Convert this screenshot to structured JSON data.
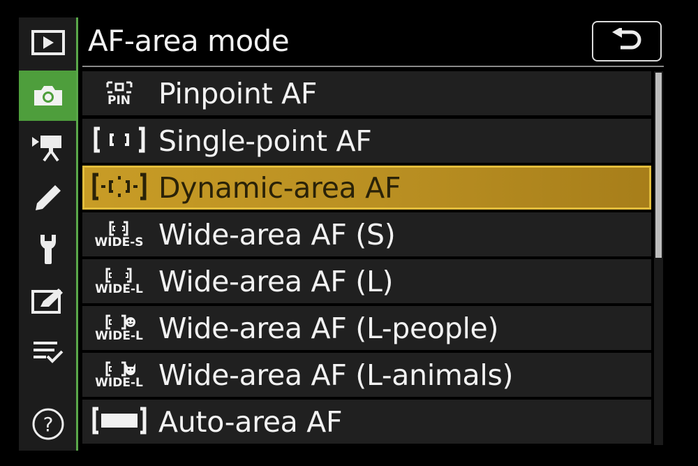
{
  "header": {
    "title": "AF-area mode"
  },
  "sidebar": {
    "items": [
      {
        "icon": "playback-icon",
        "active": false
      },
      {
        "icon": "camera-icon",
        "active": true
      },
      {
        "icon": "movie-camera-icon",
        "active": false
      },
      {
        "icon": "pencil-icon",
        "active": false
      },
      {
        "icon": "wrench-icon",
        "active": false
      },
      {
        "icon": "retouch-icon",
        "active": false
      },
      {
        "icon": "my-menu-icon",
        "active": false
      },
      {
        "icon": "help-icon",
        "active": false
      }
    ],
    "accent_color": "#4e9e3c"
  },
  "back_button": {
    "icon": "return-arrow-icon"
  },
  "menu": {
    "selected_index": 2,
    "highlight_color": "#c89c26",
    "items": [
      {
        "label": "Pinpoint AF",
        "icon": "pinpoint-af-icon",
        "icon_text": "PIN"
      },
      {
        "label": "Single-point AF",
        "icon": "single-point-af-icon"
      },
      {
        "label": "Dynamic-area AF",
        "icon": "dynamic-area-af-icon"
      },
      {
        "label": "Wide-area AF (S)",
        "icon": "wide-area-s-icon",
        "icon_text": "WIDE-S"
      },
      {
        "label": "Wide-area AF (L)",
        "icon": "wide-area-l-icon",
        "icon_text": "WIDE-L"
      },
      {
        "label": "Wide-area AF (L-people)",
        "icon": "wide-area-l-people-icon",
        "icon_text": "WIDE-L"
      },
      {
        "label": "Wide-area AF (L-animals)",
        "icon": "wide-area-l-animals-icon",
        "icon_text": "WIDE-L"
      },
      {
        "label": "Auto-area AF",
        "icon": "auto-area-af-icon"
      }
    ]
  },
  "scrollbar": {
    "visible_fraction": 0.5,
    "position": 0
  }
}
